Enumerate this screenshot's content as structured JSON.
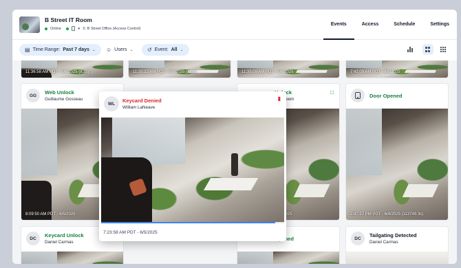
{
  "header": {
    "title": "B Street IT Room",
    "status": "Online",
    "location": "0. B Street Office (Access Control)",
    "tabs": [
      "Events",
      "Access",
      "Schedule",
      "Settings"
    ],
    "active_tab": "Events"
  },
  "filters": {
    "time_range_label": "Time Range:",
    "time_range_value": "Past 7 days",
    "users_label": "Users",
    "event_label": "Event:",
    "event_value": "All"
  },
  "top_row": [
    {
      "caption": "11:36:58 AM PDT - 6/6/2025 (8.3s)"
    },
    {
      "caption": "11:35:12 AM PDT - 6/6/2025 (8.0s)"
    },
    {
      "caption": "11:35:09 AM PDT - 6/6/2025"
    },
    {
      "caption": "7:42:09 AM PDT - 6/6/2025"
    }
  ],
  "middle_row": [
    {
      "initials": "GG",
      "title": "Web Unlock",
      "name": "Guillaume Gosseau",
      "caption": "8:09:50 AM PDT - 6/5/2025"
    },
    {
      "title": "Unlock",
      "name": "harobeem",
      "caption": "6/4/2025",
      "icon": "monitor-icon"
    },
    {
      "title": "Door Opened",
      "caption": "2:47:27 PM PDT - 6/4/2025 (113749.3s)"
    }
  ],
  "bottom_row": [
    {
      "initials": "DC",
      "title": "Keycard Unlock",
      "name": "Daniel Carmas"
    },
    {
      "title": "Opened"
    },
    {
      "initials": "DC",
      "title": "Tailgating Detected",
      "name": "Daniel Carmas"
    }
  ],
  "popup": {
    "initials": "WL",
    "title": "Keycard Denied",
    "name": "William LaNeave",
    "caption": "7:23:58 AM PDT - 6/5/2025",
    "progress": 0.95
  },
  "colors": {
    "accent": "#3b82f6",
    "success": "#15803d",
    "danger": "#dc2626",
    "chip": "#e4effd"
  }
}
